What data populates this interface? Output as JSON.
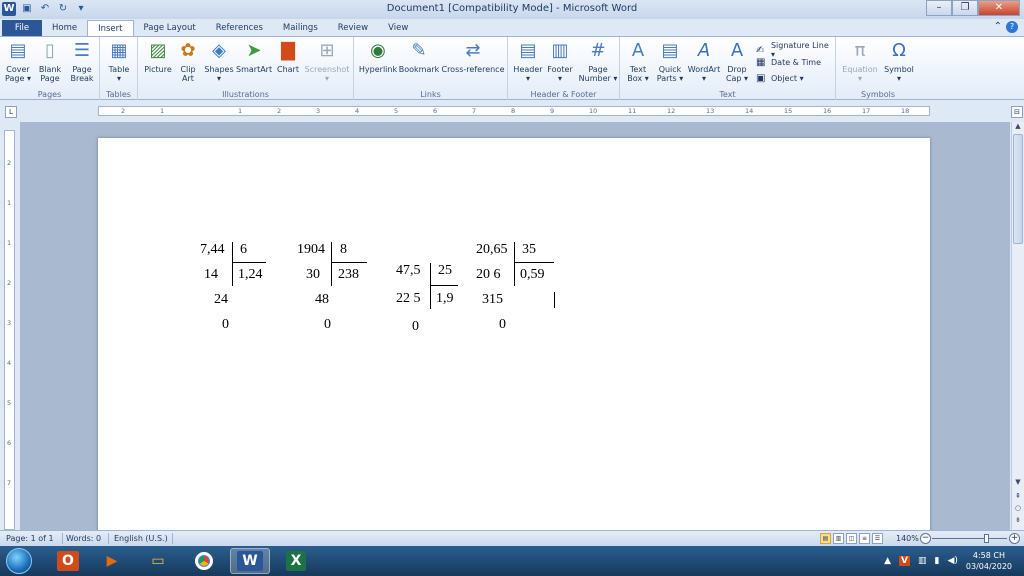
{
  "window": {
    "title": "Document1 [Compatibility Mode] - Microsoft Word",
    "app_icon": "W",
    "quick_access": [
      "save-icon",
      "undo-icon",
      "redo-icon",
      "customize-icon"
    ]
  },
  "tabs": [
    "File",
    "Home",
    "Insert",
    "Page Layout",
    "References",
    "Mailings",
    "Review",
    "View"
  ],
  "active_tab": "Insert",
  "ribbon": {
    "pages": {
      "label": "Pages",
      "cover": "Cover\nPage ▾",
      "blank": "Blank\nPage",
      "break": "Page\nBreak"
    },
    "tables": {
      "label": "Tables",
      "table": "Table\n▾"
    },
    "illustrations": {
      "label": "Illustrations",
      "picture": "Picture",
      "clipart": "Clip\nArt",
      "shapes": "Shapes\n▾",
      "smartart": "SmartArt",
      "chart": "Chart",
      "screenshot": "Screenshot\n▾"
    },
    "links": {
      "label": "Links",
      "hyperlink": "Hyperlink",
      "bookmark": "Bookmark",
      "crossref": "Cross-reference"
    },
    "headerfooter": {
      "label": "Header & Footer",
      "header": "Header\n▾",
      "footer": "Footer\n▾",
      "pagenum": "Page\nNumber ▾"
    },
    "text": {
      "label": "Text",
      "textbox": "Text\nBox ▾",
      "quickparts": "Quick\nParts ▾",
      "wordart": "WordArt\n▾",
      "dropcap": "Drop\nCap ▾",
      "signature": "Signature Line ▾",
      "datetime": "Date & Time",
      "object": "Object ▾"
    },
    "symbols": {
      "label": "Symbols",
      "equation": "Equation\n▾",
      "symbol": "Symbol\n▾"
    }
  },
  "ruler_marks": [
    "2",
    "1",
    "1",
    "2",
    "3",
    "4",
    "5",
    "6",
    "7",
    "8",
    "9",
    "10",
    "11",
    "12",
    "13",
    "14",
    "15",
    "16",
    "17",
    "18"
  ],
  "vruler_marks": [
    "2",
    "1",
    "1",
    "2",
    "3",
    "4",
    "5",
    "6",
    "7"
  ],
  "document": {
    "div1": {
      "dividend": "7,44",
      "divisor": "6",
      "r1": "14",
      "quotient": "1,24",
      "r2": "24",
      "r3": "0"
    },
    "div2": {
      "dividend": "1904",
      "divisor": "8",
      "r1": "30",
      "quotient": "238",
      "r2": "48",
      "r3": "0"
    },
    "div3": {
      "dividend": "47,5",
      "divisor": "25",
      "r1": "22 5",
      "quotient": "1,9",
      "r2": "0"
    },
    "div4": {
      "dividend": "20,65",
      "divisor": "35",
      "r1": "20 6",
      "quotient": "0,59",
      "r2": "315",
      "r3": "0"
    }
  },
  "status": {
    "page": "Page: 1 of 1",
    "words": "Words: 0",
    "language": "English (U.S.)",
    "zoom": "140%"
  },
  "taskbar": {
    "time": "4:58 CH",
    "date": "03/04/2020"
  }
}
